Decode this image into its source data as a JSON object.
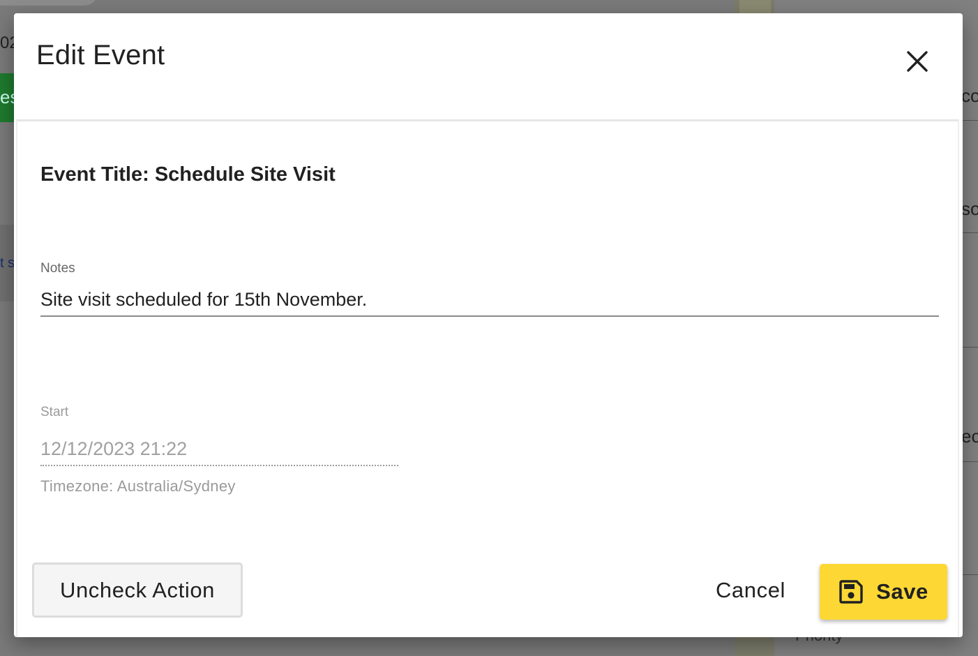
{
  "background": {
    "left_text": "02",
    "green_text": "es",
    "left_link_text": "t s",
    "right_texts": [
      "co",
      "so",
      "ec"
    ],
    "bottom_text": "Priority"
  },
  "dialog": {
    "title": "Edit Event",
    "close_icon": "close-icon",
    "event_title": "Event Title: Schedule Site Visit",
    "notes": {
      "label": "Notes",
      "value": "Site visit scheduled for 15th November."
    },
    "start": {
      "label": "Start",
      "value": "12/12/2023 21:22",
      "timezone": "Timezone: Australia/Sydney"
    },
    "actions": {
      "uncheck_label": "Uncheck Action",
      "cancel_label": "Cancel",
      "save_label": "Save",
      "save_icon": "floppy-disk-icon"
    }
  },
  "colors": {
    "save_button": "#fdd835",
    "overlay": "#7a7a7a"
  }
}
